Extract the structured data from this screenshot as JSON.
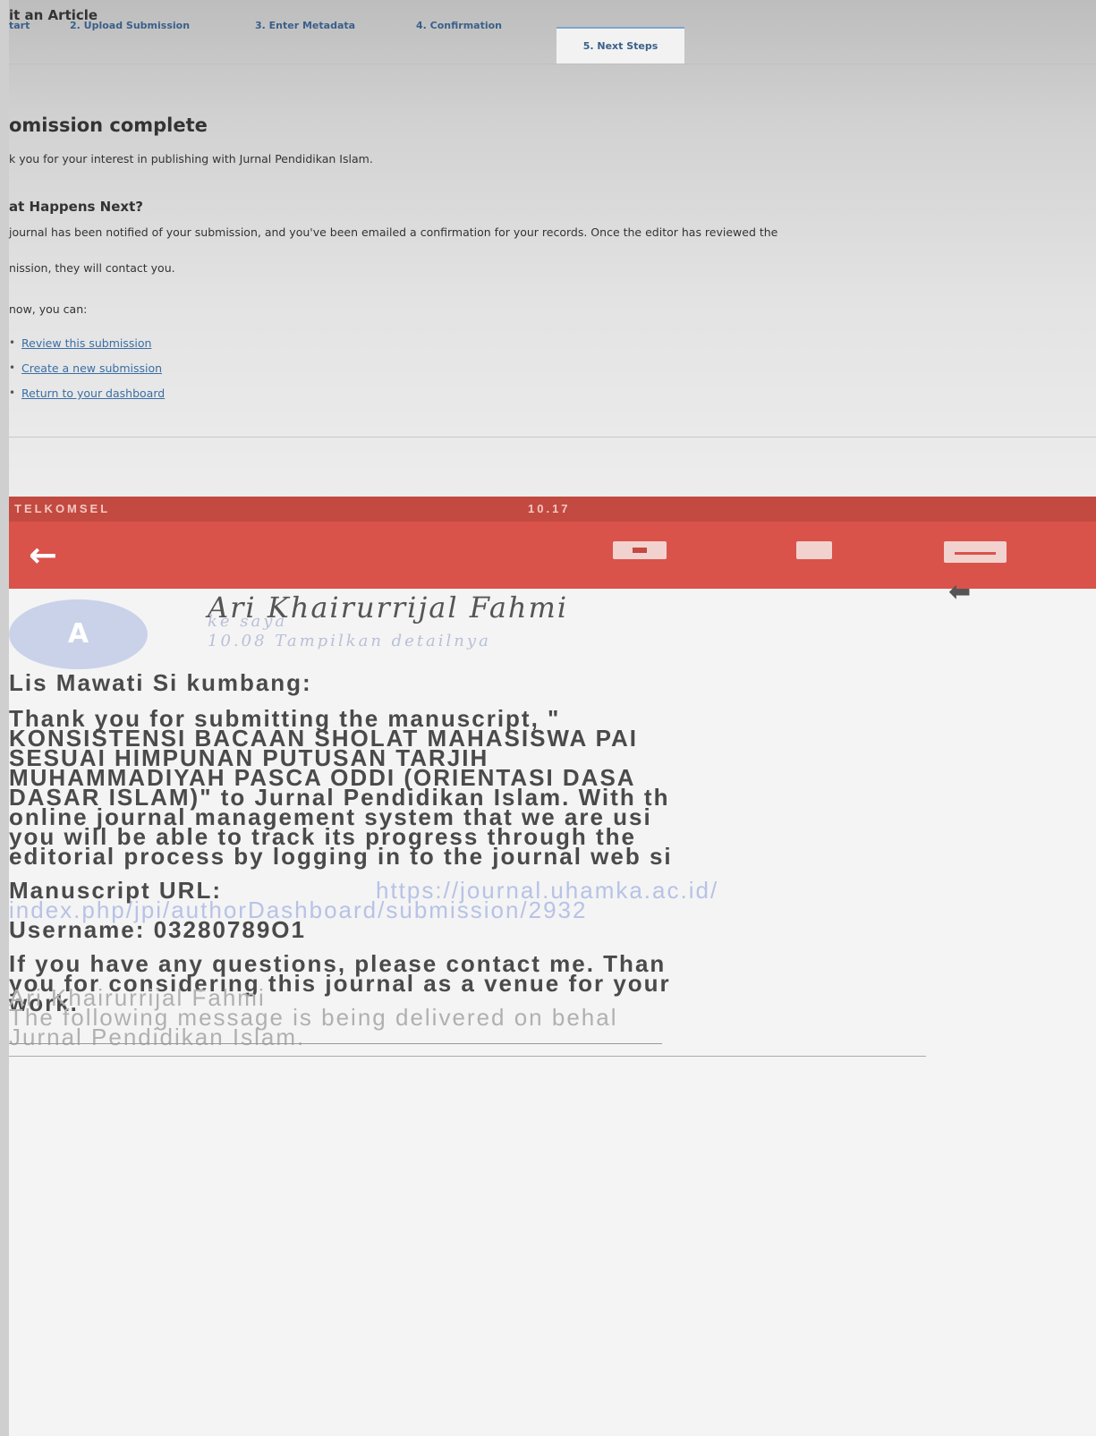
{
  "page": {
    "header_title": "it an Article",
    "steps": [
      "tart",
      "2. Upload Submission",
      "3. Enter Metadata",
      "4. Confirmation",
      "5. Next Steps"
    ],
    "title": "omission complete",
    "thanks": "k you for your interest in publishing with Jurnal Pendidikan Islam.",
    "subheading": "at Happens Next?",
    "notice_line1": "journal has been notified of your submission, and you've been emailed a confirmation for your records. Once the editor has reviewed the",
    "notice_line2": "nission, they will contact you.",
    "now": "now, you can:",
    "links": [
      "Review this submission",
      "Create a new submission",
      "Return to your dashboard"
    ]
  },
  "phone": {
    "status_left": "TELKOMSEL",
    "status_time": "10.17",
    "accent_color": "#d9534a",
    "icons": [
      "back-arrow-icon",
      "archive-icon",
      "delete-icon",
      "mail-icon",
      "reply-icon"
    ]
  },
  "email": {
    "avatar_letter": "A",
    "sender": "Ari Khairurrijal Fahmi",
    "to": "ke saya",
    "time_detail": "10.08 Tampilkan detailnya",
    "greeting": "Lis Mawati Si kumbang:",
    "body_lines": [
      "Thank you for submitting the manuscript, \"",
      "KONSISTENSI BACAAN SHOLAT MAHASISWA PAI",
      "SESUAI HIMPUNAN PUTUSAN TARJIH",
      "MUHAMMADIYAH PASCA ODDI (ORIENTASI DASA",
      "DASAR ISLAM)\" to Jurnal Pendidikan Islam. With th",
      "online journal management system that we are usi",
      "you will be able to track its progress through the",
      "editorial process by logging in to the journal web si"
    ],
    "url_label": "Manuscript URL:",
    "url_part1": "https://journal.uhamka.ac.id/",
    "url_part2": "index.php/jpi/authorDashboard/submission/2932",
    "username": "Username: 03280789O1",
    "closing_lines": [
      "If you have any questions, please contact me. Than",
      "you for considering this journal as a venue for your",
      "work."
    ],
    "signature_lines": [
      "Ari Khairurrijal Fahmi",
      "The following message is being delivered on behal",
      "Jurnal Pendidikan Islam."
    ]
  }
}
